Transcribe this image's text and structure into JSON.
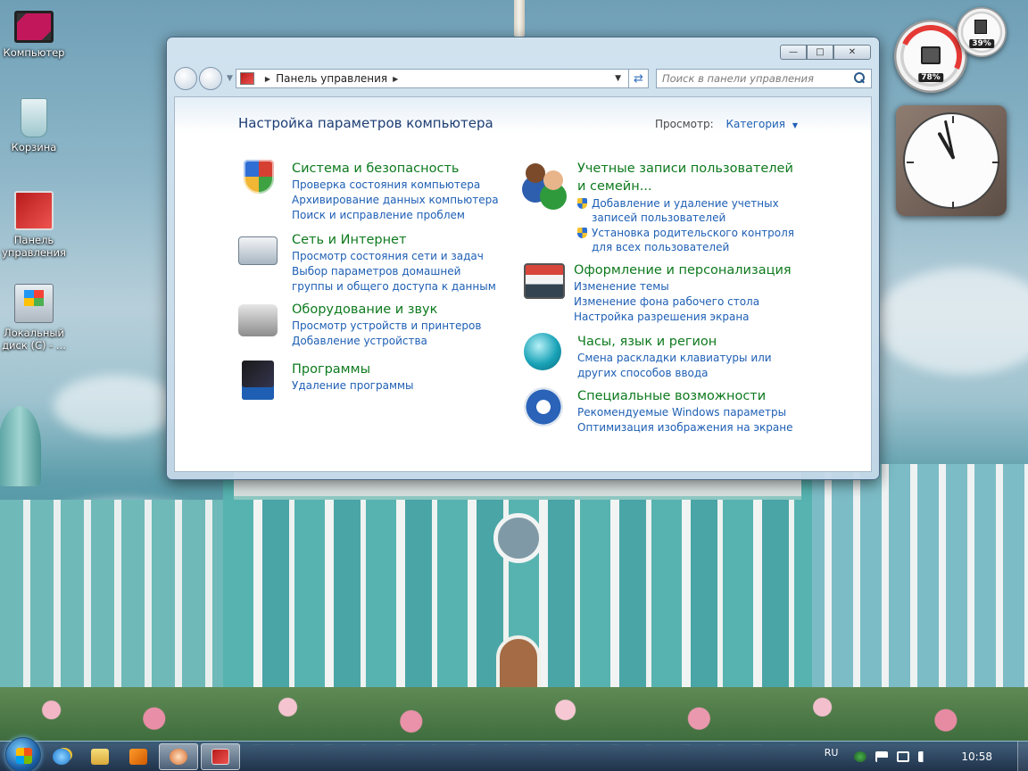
{
  "desktop": {
    "icons": [
      {
        "label": "Компьютер"
      },
      {
        "label": "Корзина"
      },
      {
        "label": "Панель управления"
      },
      {
        "label": "Локальный диск (C) - ..."
      }
    ]
  },
  "gadgets": {
    "cpu_percent": "78%",
    "memory_percent": "39%",
    "clock_icon": "analog-clock-icon"
  },
  "window": {
    "breadcrumb": "Панель управления",
    "search_placeholder": "Поиск в панели управления",
    "heading": "Настройка параметров компьютера",
    "view_label": "Просмотр:",
    "view_value": "Категория",
    "categories_left": [
      {
        "title": "Система и безопасность",
        "icon": "security-shield-icon",
        "links": [
          "Проверка состояния компьютера",
          "Архивирование данных компьютера",
          "Поиск и исправление проблем"
        ]
      },
      {
        "title": "Сеть и Интернет",
        "icon": "network-icon",
        "links": [
          "Просмотр состояния сети и задач",
          "Выбор параметров домашней группы и общего доступа к данным"
        ]
      },
      {
        "title": "Оборудование и звук",
        "icon": "printer-icon",
        "links": [
          "Просмотр устройств и принтеров",
          "Добавление устройства"
        ]
      },
      {
        "title": "Программы",
        "icon": "programs-box-icon",
        "links": [
          "Удаление программы"
        ]
      }
    ],
    "categories_right": [
      {
        "title": "Учетные записи пользователей и семейн...",
        "icon": "users-icon",
        "links": [
          "Добавление и удаление учетных записей пользователей",
          "Установка родительского контроля для всех пользователей"
        ]
      },
      {
        "title": "Оформление и персонализация",
        "icon": "appearance-palette-icon",
        "links": [
          "Изменение темы",
          "Изменение фона рабочего стола",
          "Настройка разрешения экрана"
        ]
      },
      {
        "title": "Часы, язык и регион",
        "icon": "globe-clock-icon",
        "links": [
          "Смена раскладки клавиатуры или других способов ввода"
        ]
      },
      {
        "title": "Специальные возможности",
        "icon": "accessibility-icon",
        "links": [
          "Рекомендуемые Windows параметры",
          "Оптимизация изображения на экране"
        ]
      }
    ]
  },
  "taskbar": {
    "language": "RU",
    "time": "10:58"
  }
}
